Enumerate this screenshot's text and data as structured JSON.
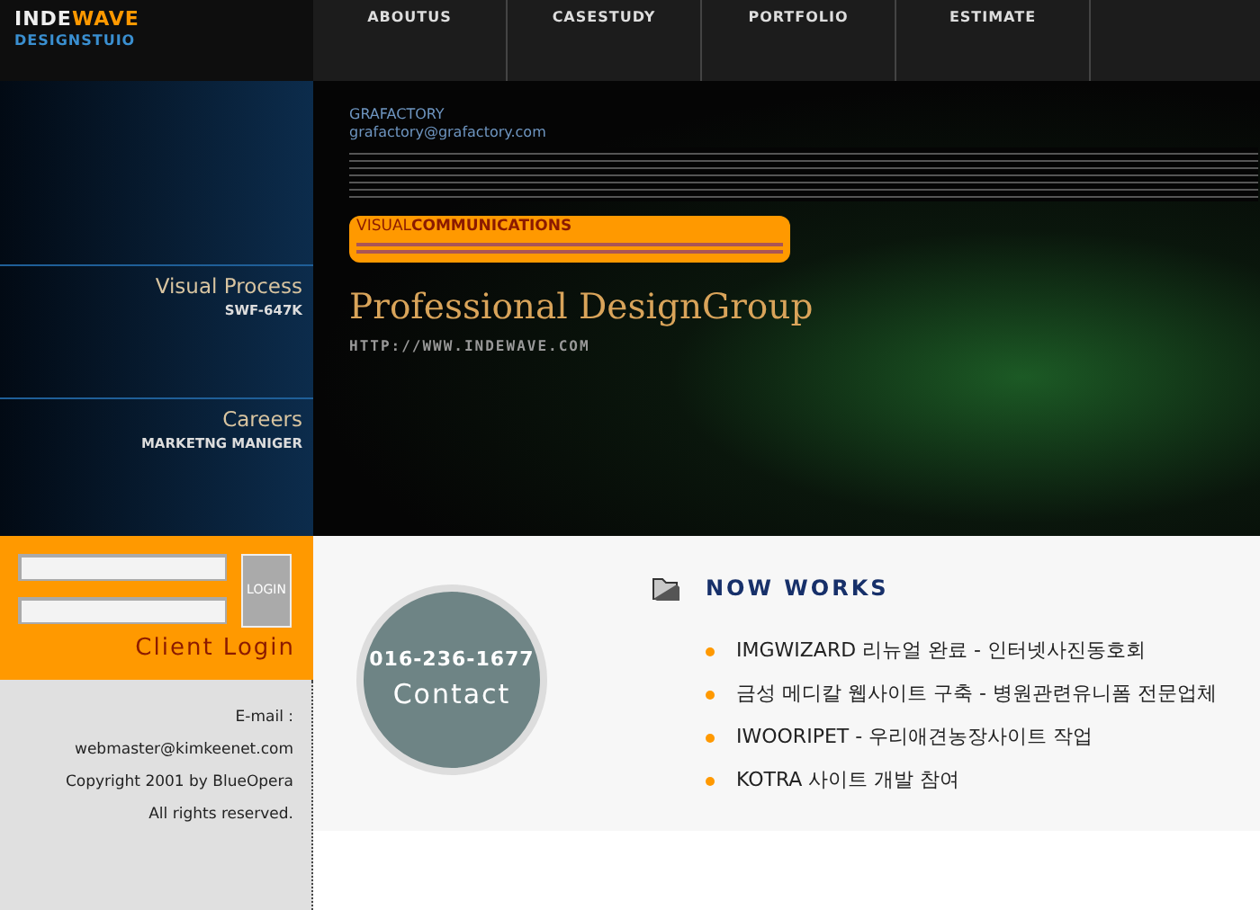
{
  "logo": {
    "part_1": "INDE",
    "part_2": "WAVE",
    "subtitle": "DESIGNSTUIO"
  },
  "nav": [
    {
      "label": "ABOUTUS"
    },
    {
      "label": "CASESTUDY"
    },
    {
      "label": "PORTFOLIO"
    },
    {
      "label": "ESTIMATE"
    }
  ],
  "side_sections": [
    {
      "title": "Visual Process",
      "subtitle": "SWF-647K"
    },
    {
      "title": "Careers",
      "subtitle": "MARKETNG MANIGER"
    }
  ],
  "hero": {
    "company": "GRAFACTORY",
    "email": "grafactory@grafactory.com",
    "bubble_title_1": "VISUAL",
    "bubble_title_2": "COMMUNICATIONS",
    "headline": "Professional DesignGroup",
    "url": "HTTP://WWW.INDEWAVE.COM"
  },
  "login": {
    "button": "LOGIN",
    "caption": "Client Login"
  },
  "footer": [
    "E-mail : webmaster@kimkeenet.com",
    "Copyright 2001 by BlueOpera",
    "All rights reserved."
  ],
  "contact": {
    "phone": "016-236-1677",
    "label": "Contact"
  },
  "now_works": {
    "title": "NOW WORKS",
    "items": [
      "IMGWIZARD 리뉴얼 완료 - 인터넷사진동호회",
      "금성 메디칼 웹사이트 구축 - 병원관련유니폼 전문업체",
      "IWOORIPET - 우리애견농장사이트 작업",
      "KOTRA 사이트 개발 참여"
    ]
  }
}
